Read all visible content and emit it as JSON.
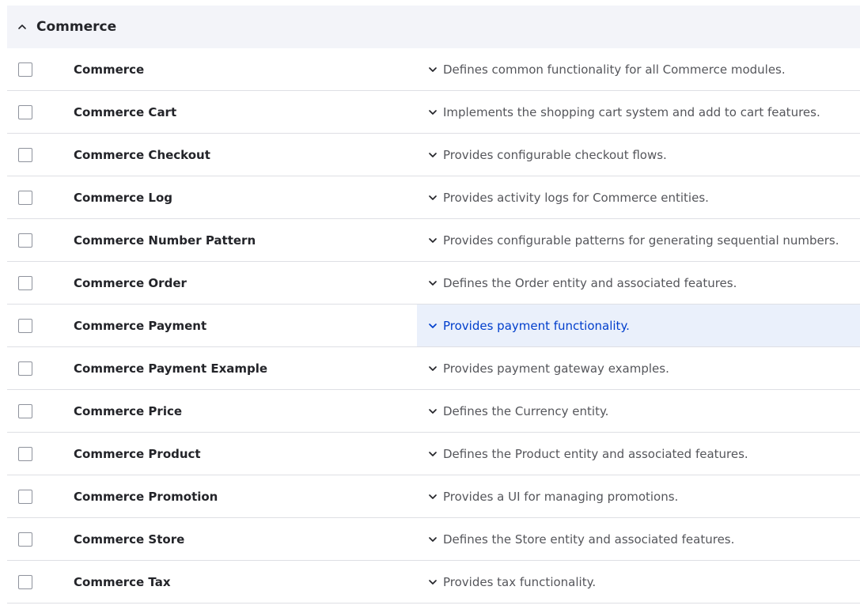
{
  "group": {
    "title": "Commerce",
    "expanded": true
  },
  "colors": {
    "header_bg": "#f3f4f9",
    "active_bg": "#eaf0fb",
    "link_blue": "#003ecc",
    "text_dark": "#232429",
    "text_muted": "#55565b"
  },
  "modules": [
    {
      "name": "Commerce",
      "description": "Defines common functionality for all Commerce modules.",
      "checked": false,
      "active": false
    },
    {
      "name": "Commerce Cart",
      "description": "Implements the shopping cart system and add to cart features.",
      "checked": false,
      "active": false
    },
    {
      "name": "Commerce Checkout",
      "description": "Provides configurable checkout flows.",
      "checked": false,
      "active": false
    },
    {
      "name": "Commerce Log",
      "description": "Provides activity logs for Commerce entities.",
      "checked": false,
      "active": false
    },
    {
      "name": "Commerce Number Pattern",
      "description": "Provides configurable patterns for generating sequential numbers.",
      "checked": false,
      "active": false
    },
    {
      "name": "Commerce Order",
      "description": "Defines the Order entity and associated features.",
      "checked": false,
      "active": false
    },
    {
      "name": "Commerce Payment",
      "description": "Provides payment functionality.",
      "checked": false,
      "active": true
    },
    {
      "name": "Commerce Payment Example",
      "description": "Provides payment gateway examples.",
      "checked": false,
      "active": false
    },
    {
      "name": "Commerce Price",
      "description": "Defines the Currency entity.",
      "checked": false,
      "active": false
    },
    {
      "name": "Commerce Product",
      "description": "Defines the Product entity and associated features.",
      "checked": false,
      "active": false
    },
    {
      "name": "Commerce Promotion",
      "description": "Provides a UI for managing promotions.",
      "checked": false,
      "active": false
    },
    {
      "name": "Commerce Store",
      "description": "Defines the Store entity and associated features.",
      "checked": false,
      "active": false
    },
    {
      "name": "Commerce Tax",
      "description": "Provides tax functionality.",
      "checked": false,
      "active": false
    }
  ]
}
